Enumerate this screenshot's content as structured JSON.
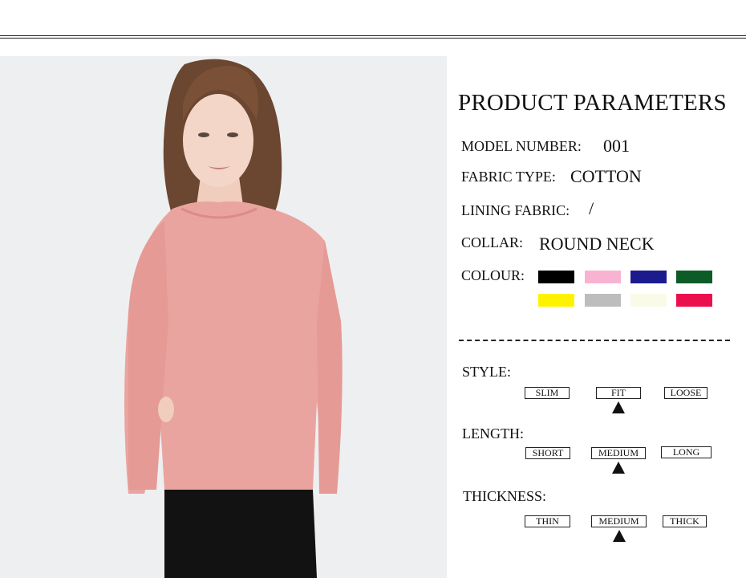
{
  "heading": "PRODUCT PARAMETERS",
  "model": {
    "label": "MODEL NUMBER:",
    "value": "001"
  },
  "fabric": {
    "label": "FABRIC TYPE:",
    "value": "COTTON"
  },
  "lining": {
    "label": "LINING FABRIC:",
    "value": "/"
  },
  "collar": {
    "label": "COLLAR:",
    "value": "ROUND NECK"
  },
  "colour": {
    "label": "COLOUR:",
    "swatches": [
      "#000000",
      "#f9b3d2",
      "#1b1b8e",
      "#0d5c27",
      "#fff200",
      "#bdbdbd",
      "#fafae8",
      "#ec0f4d"
    ]
  },
  "style": {
    "label": "STYLE:",
    "options": [
      "SLIM",
      "FIT",
      "LOOSE"
    ],
    "selected": "FIT"
  },
  "length": {
    "label": "LENGTH:",
    "options": [
      "SHORT",
      "MEDIUM",
      "LONG"
    ],
    "selected": "MEDIUM"
  },
  "thickness": {
    "label": "THICKNESS:",
    "options": [
      "THIN",
      "MEDIUM",
      "THICK"
    ],
    "selected": "MEDIUM"
  },
  "photo": {
    "subject": "model wearing pink ribbed long-sleeve round-neck knit top"
  }
}
